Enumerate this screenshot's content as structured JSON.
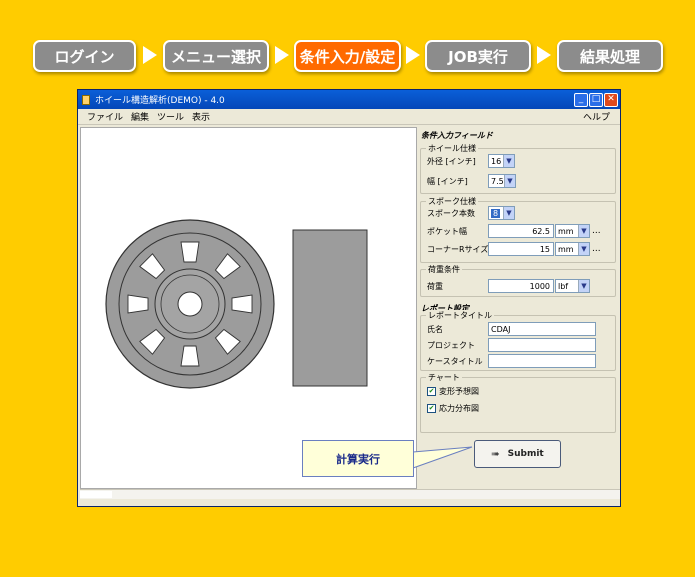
{
  "steps": [
    {
      "label": "ログイン",
      "active": false
    },
    {
      "label": "メニュー選択",
      "active": false
    },
    {
      "label": "条件入力/設定",
      "active": true
    },
    {
      "label": "JOB実行",
      "active": false
    },
    {
      "label": "結果処理",
      "active": false
    }
  ],
  "window": {
    "title": "ホイール構造解析(DEMO) - 4.0",
    "menu": {
      "file": "ファイル",
      "edit": "編集",
      "tool": "ツール",
      "view": "表示",
      "help": "ヘルプ"
    }
  },
  "panel": {
    "title": "条件入力フィールド",
    "wheel_spec": {
      "label": "ホイール仕様",
      "outer_label": "外径 [インチ]",
      "outer_value": "16",
      "width_label": "幅 [インチ]",
      "width_value": "7.5"
    },
    "spoke_spec": {
      "label": "スポーク仕様",
      "count_label": "スポーク本数",
      "count_value": "8",
      "pocket_label": "ポケット幅",
      "pocket_value": "62.5",
      "pocket_unit": "mm",
      "corner_label": "コーナーRサイズ",
      "corner_value": "15",
      "corner_unit": "mm",
      "more": "..."
    },
    "load": {
      "label": "荷重条件",
      "load_label": "荷重",
      "load_value": "1000",
      "load_unit": "lbf"
    },
    "report_title": "レポート設定",
    "report": {
      "label": "レポートタイトル",
      "name_label": "氏名",
      "name_value": "CDAJ",
      "project_label": "プロジェクト",
      "project_value": "",
      "case_label": "ケースタイトル",
      "case_value": ""
    },
    "chart": {
      "label": "チャート",
      "opt1": "変形予想図",
      "opt1_checked": true,
      "opt2": "応力分布図",
      "opt2_checked": true
    }
  },
  "submit_label": "Submit",
  "callout_label": "計算実行",
  "colors": {
    "background": "#ffcc00",
    "active_step": "#ff6a00",
    "inactive_step": "#8c8c8c",
    "titlebar": "#0a5fd8"
  }
}
